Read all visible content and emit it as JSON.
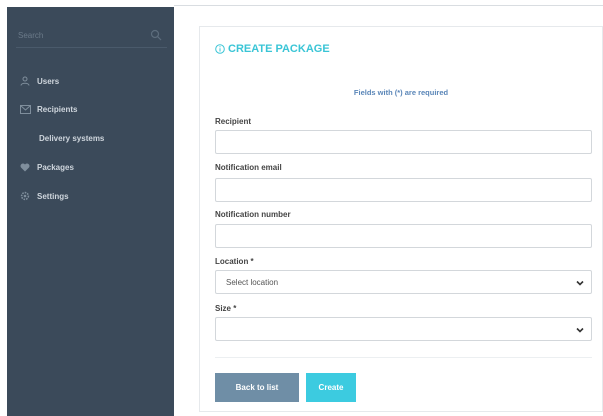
{
  "sidebar": {
    "search": {
      "placeholder": "Search",
      "icon": "search-icon"
    },
    "items": [
      {
        "label": "Users",
        "icon": "user-icon"
      },
      {
        "label": "Recipients",
        "icon": "envelope-icon"
      },
      {
        "label": "Delivery systems",
        "icon": ""
      },
      {
        "label": "Packages",
        "icon": "heart-icon"
      },
      {
        "label": "Settings",
        "icon": "gear-icon"
      }
    ],
    "background": "#3b4a5a"
  },
  "form": {
    "title": "CREATE PACKAGE",
    "title_icon": "info-circle-icon",
    "required_note": "Fields with (*) are required",
    "fields": {
      "recipient": {
        "label": "Recipient",
        "value": ""
      },
      "notification_email": {
        "label": "Notification email",
        "value": ""
      },
      "notification_number": {
        "label": "Notification number",
        "value": ""
      },
      "location": {
        "label": "Location *",
        "selected": "Select location"
      },
      "size": {
        "label": "Size *",
        "selected": ""
      }
    },
    "buttons": {
      "back": "Back to list",
      "create": "Create"
    },
    "accent": "#3ac5d6"
  }
}
